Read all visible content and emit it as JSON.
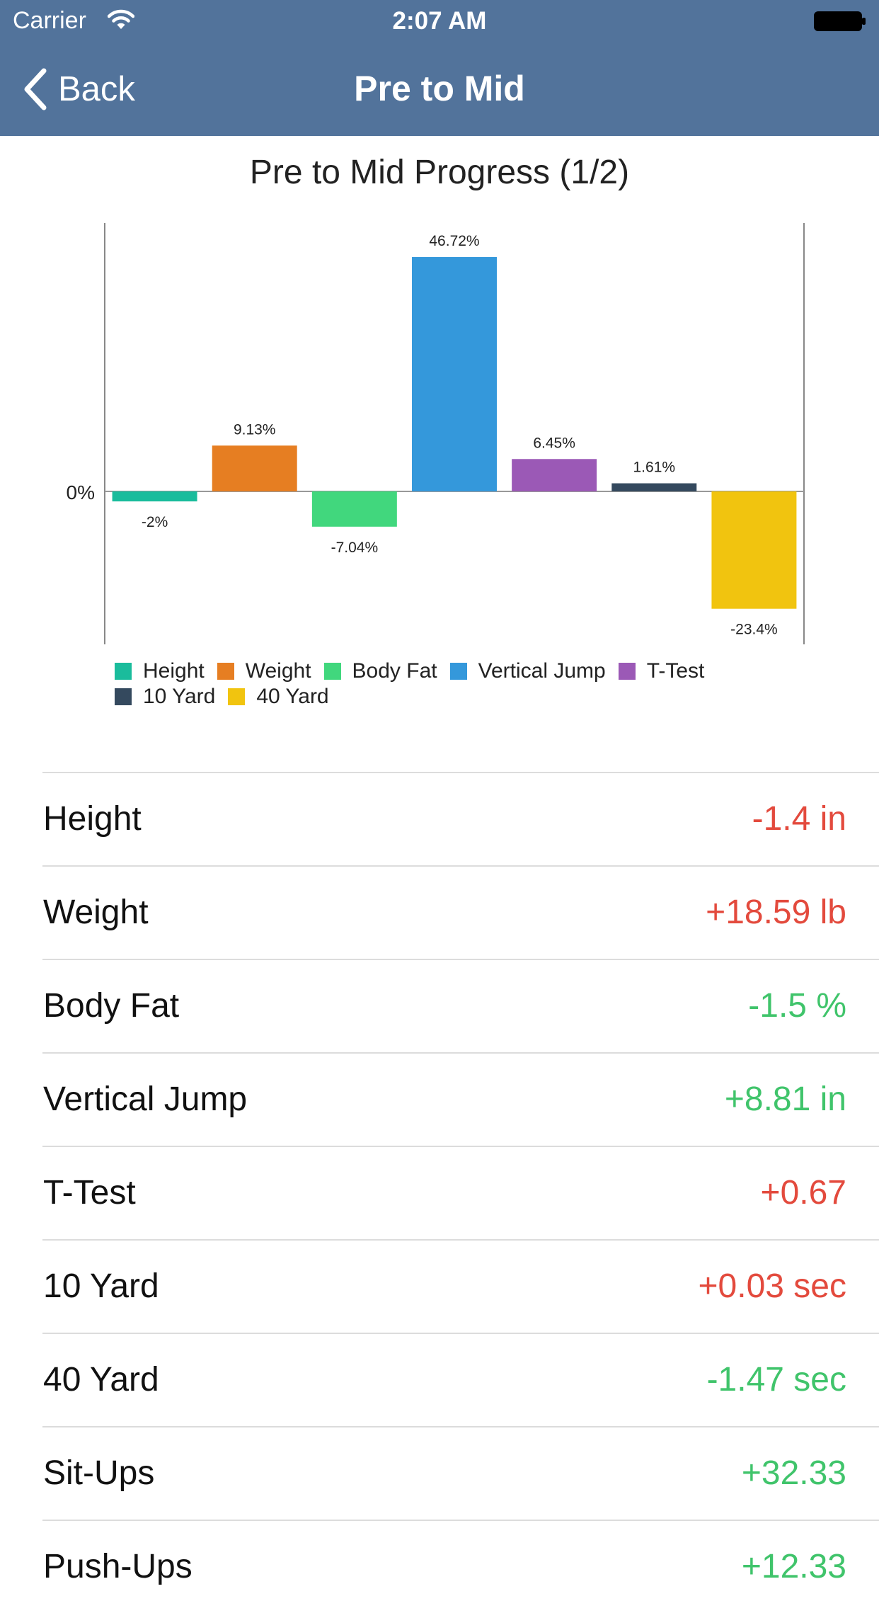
{
  "status_bar": {
    "carrier": "Carrier",
    "time": "2:07 AM"
  },
  "nav": {
    "back_label": "Back",
    "title": "Pre to Mid"
  },
  "chart_title": "Pre to Mid Progress (1/2)",
  "colors": {
    "header": "#52739b",
    "negative": "#e34a3d",
    "positive": "#40c46b"
  },
  "chart_data": {
    "type": "bar",
    "title": "Pre to Mid Progress (1/2)",
    "categories": [
      "Height",
      "Weight",
      "Body Fat",
      "Vertical Jump",
      "T-Test",
      "10 Yard",
      "40 Yard"
    ],
    "values": [
      -2,
      9.13,
      -7.04,
      46.72,
      6.45,
      1.61,
      -23.4
    ],
    "data_labels": [
      "-2%",
      "9.13%",
      "-7.04%",
      "46.72%",
      "6.45%",
      "1.61%",
      "-23.4%"
    ],
    "colors": [
      "#1abc9c",
      "#e67e22",
      "#41d77d",
      "#3498db",
      "#9b59b6",
      "#34495e",
      "#f1c40f"
    ],
    "y_tick_label": "0%",
    "ylim": [
      -30.5,
      53.5
    ],
    "grid": false,
    "legend_position": "bottom"
  },
  "legend": [
    {
      "label": "Height",
      "color": "#1abc9c"
    },
    {
      "label": "Weight",
      "color": "#e67e22"
    },
    {
      "label": "Body Fat",
      "color": "#41d77d"
    },
    {
      "label": "Vertical Jump",
      "color": "#3498db"
    },
    {
      "label": "T-Test",
      "color": "#9b59b6"
    },
    {
      "label": "10 Yard",
      "color": "#34495e"
    },
    {
      "label": "40 Yard",
      "color": "#f1c40f"
    }
  ],
  "rows": [
    {
      "label": "Height",
      "value": "-1.4 in",
      "status": "negative"
    },
    {
      "label": "Weight",
      "value": "+18.59 lb",
      "status": "negative"
    },
    {
      "label": "Body Fat",
      "value": "-1.5 %",
      "status": "positive"
    },
    {
      "label": "Vertical Jump",
      "value": "+8.81 in",
      "status": "positive"
    },
    {
      "label": "T-Test",
      "value": "+0.67",
      "status": "negative"
    },
    {
      "label": "10 Yard",
      "value": "+0.03 sec",
      "status": "negative"
    },
    {
      "label": "40 Yard",
      "value": "-1.47 sec",
      "status": "positive"
    },
    {
      "label": "Sit-Ups",
      "value": "+32.33",
      "status": "positive"
    },
    {
      "label": "Push-Ups",
      "value": "+12.33",
      "status": "positive"
    }
  ]
}
